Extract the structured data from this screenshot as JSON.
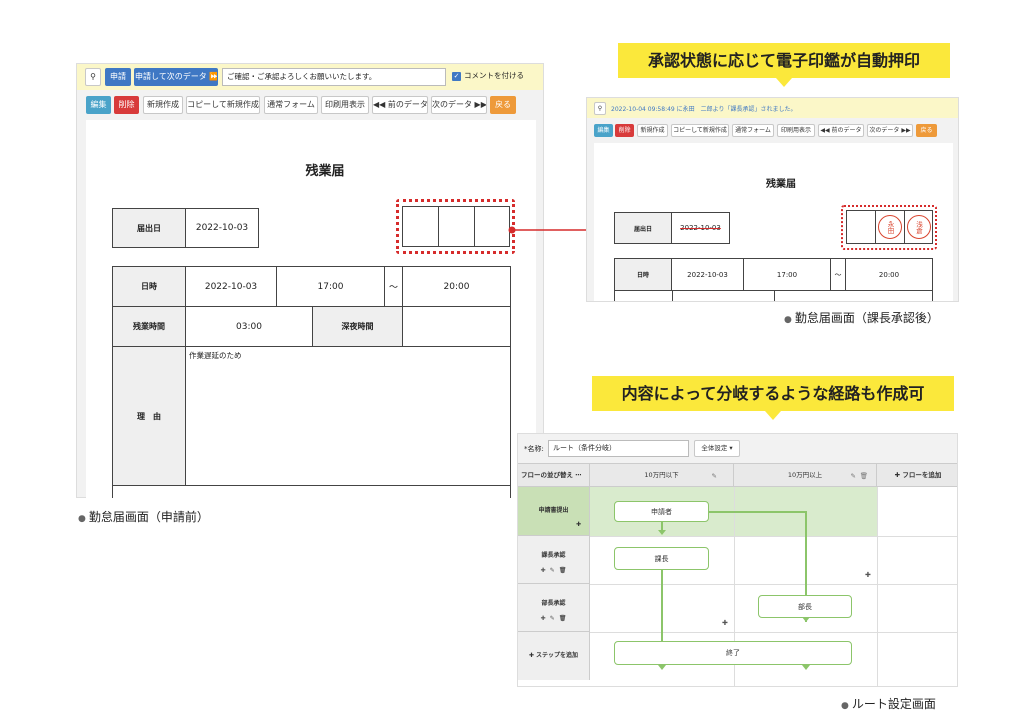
{
  "screen1": {
    "caption": "勤怠届画面（申請前）",
    "toolbar1": {
      "pin_icon": "map-pin-icon",
      "apply_label": "申請",
      "apply_next_label": "申請して次のデータ ⏩",
      "comment_value": "ご確認・ご承認よろしくお願いいたします。",
      "comment_checkbox_label": "コメントを付ける"
    },
    "toolbar2": [
      "編集",
      "削除",
      "新規作成",
      "コピーして新規作成",
      "通常フォーム",
      "印刷用表示",
      "◀◀ 前のデータ",
      "次のデータ ▶▶",
      "戻る"
    ],
    "form": {
      "title": "残業届",
      "date_label": "届出日",
      "date_value": "2022-10-03",
      "datetime_label": "日時",
      "datetime_date": "2022-10-03",
      "start_time": "17:00",
      "tilde": "～",
      "end_time": "20:00",
      "overtime_label": "残業時間",
      "overtime_value": "03:00",
      "night_label": "深夜時間",
      "night_value": "",
      "reason_label": "理　由",
      "reason_value": "作業遅延のため"
    }
  },
  "screen2": {
    "callout": "承認状態に応じて電子印鑑が自動押印",
    "caption": "勤怠届画面（課長承認後）",
    "notice": "2022-10-04 09:58:49 に永田　二郎より「課長承認」されました。",
    "toolbar": [
      "編集",
      "削除",
      "新規作成",
      "コピーして新規作成",
      "通常フォーム",
      "印刷用表示",
      "◀◀ 前のデータ",
      "次のデータ ▶▶",
      "戻る"
    ],
    "form": {
      "title": "残業届",
      "date_label": "届出日",
      "date_value": "2022-10-03",
      "datetime_label": "日時",
      "datetime_date": "2022-10-03",
      "start_time": "17:00",
      "tilde": "～",
      "end_time": "20:00"
    },
    "stamps": [
      {
        "text": "永田",
        "color": "#d9452f"
      },
      {
        "text": "浅倉",
        "color": "#d9452f"
      }
    ]
  },
  "screen3": {
    "callout": "内容によって分岐するような経路も作成可",
    "caption": "ルート設定画面",
    "name_label": "*名称:",
    "name_value": "ルート（条件分岐）",
    "settings_button": "全体設定 ▾",
    "sort_label": "フローの並び替え",
    "columns": [
      "10万円以下",
      "10万円以上"
    ],
    "add_flow": "フローを追加",
    "rows": [
      "申請書提出",
      "課長承認",
      "部長承認"
    ],
    "add_step": "ステップを追加",
    "nodes": {
      "applicant": "申請者",
      "section_chief": "課長",
      "dept_head": "部長",
      "end": "終了"
    }
  },
  "colors": {
    "callout_yellow": "#fbe83b",
    "arrow_red": "#d62b2b",
    "flow_green": "#8cc56a",
    "highlight_green": "#d9ebcd"
  }
}
